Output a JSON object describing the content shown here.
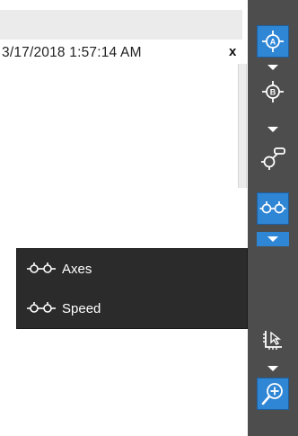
{
  "header": {
    "timestamp": "3/17/2018 1:57:14 AM",
    "close_label": "x"
  },
  "toolbar": {
    "buttons": [
      {
        "name": "probe-a-icon",
        "letter": "A",
        "active": true
      },
      {
        "name": "probe-b-icon",
        "letter": "B",
        "active": false
      },
      {
        "name": "probe-flag-icon",
        "active": false
      },
      {
        "name": "axes-probe-icon",
        "active": true
      },
      {
        "name": "select-area-icon",
        "active": false
      },
      {
        "name": "zoom-in-icon",
        "active": true
      }
    ],
    "colors": {
      "panel": "#4d4d4d",
      "active": "#2f86d5",
      "icon": "#ffffff"
    }
  },
  "menu": {
    "items": [
      {
        "label": "Axes",
        "icon": "axes-probe-icon"
      },
      {
        "label": "Speed",
        "icon": "speed-probe-icon"
      }
    ]
  }
}
